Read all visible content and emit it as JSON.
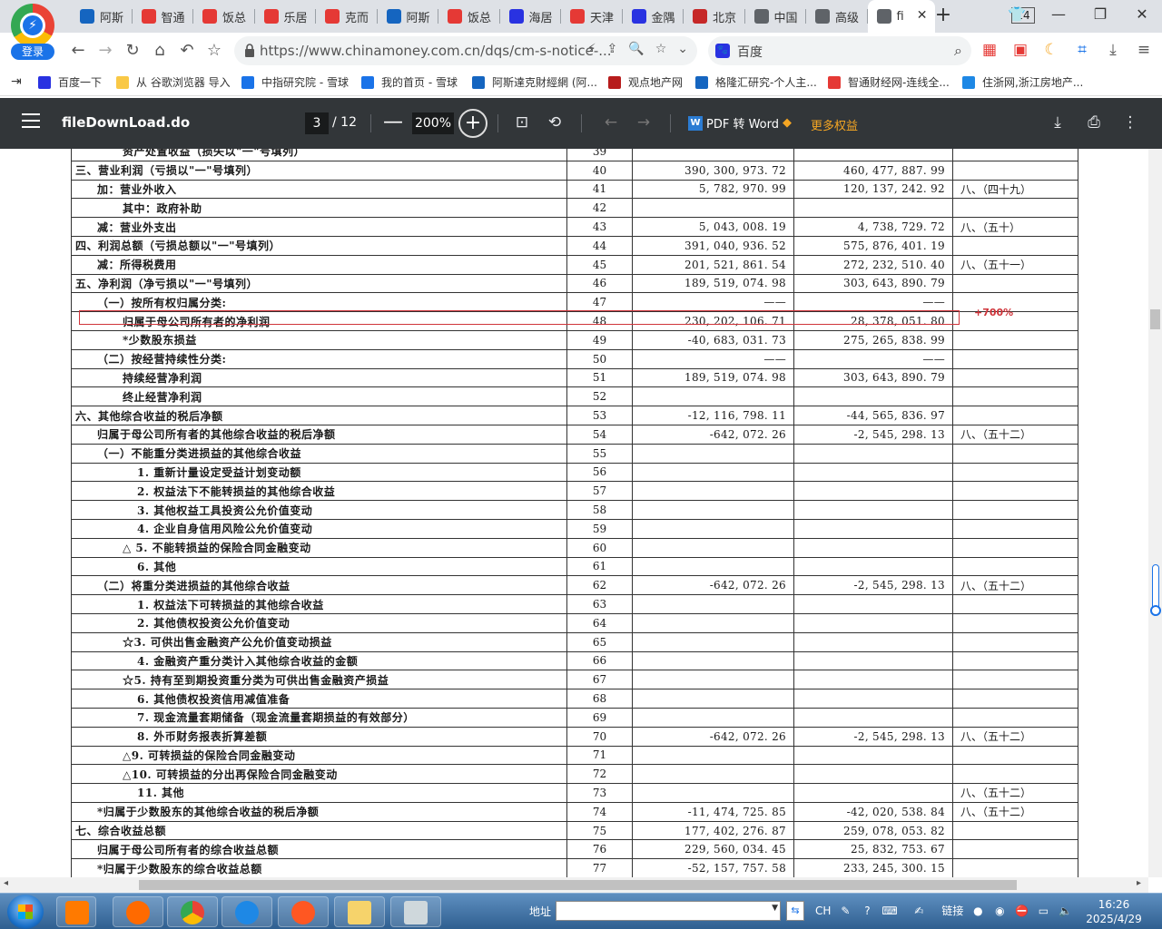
{
  "browser": {
    "login_label": "登录",
    "tabs": [
      {
        "label": "阿斯",
        "icon": "fund-icon",
        "color": "#1565c0"
      },
      {
        "label": "智通",
        "icon": "z-logo-icon",
        "color": "#e53935"
      },
      {
        "label": "饭总",
        "icon": "xueqiu-icon",
        "color": "#e53935"
      },
      {
        "label": "乐居",
        "icon": "xueqiu-icon",
        "color": "#e53935"
      },
      {
        "label": "克而",
        "icon": "xueqiu-icon",
        "color": "#e53935"
      },
      {
        "label": "阿斯",
        "icon": "fund-icon",
        "color": "#1565c0"
      },
      {
        "label": "饭总",
        "icon": "xueqiu-icon",
        "color": "#e53935"
      },
      {
        "label": "海居",
        "icon": "baidu-paw-icon",
        "color": "#2932e1"
      },
      {
        "label": "天津",
        "icon": "xueqiu-icon",
        "color": "#e53935"
      },
      {
        "label": "金隅",
        "icon": "baidu-paw-icon",
        "color": "#2932e1"
      },
      {
        "label": "北京",
        "icon": "news-icon",
        "color": "#c62828"
      },
      {
        "label": "中国",
        "icon": "globe-icon",
        "color": "#5f6368"
      },
      {
        "label": "高级",
        "icon": "globe-icon",
        "color": "#5f6368"
      },
      {
        "label": "fi",
        "icon": "globe-icon",
        "color": "#5f6368",
        "active": true
      }
    ],
    "tab_count": "14",
    "url": "https://www.chinamoney.com.cn/dqs/cm-s-notice-...",
    "search_placeholder": "百度",
    "bookmarks": [
      {
        "label": "百度一下",
        "icon": "baidu-paw-icon",
        "color": "#2932e1"
      },
      {
        "label": "从 谷歌浏览器 导入",
        "icon": "folder-icon",
        "color": "#f9c846"
      },
      {
        "label": "中指研究院 - 雪球",
        "icon": "xueqiu-icon",
        "color": "#1a73e8"
      },
      {
        "label": "我的首页 - 雪球",
        "icon": "xueqiu-icon",
        "color": "#1a73e8"
      },
      {
        "label": "阿斯達克財經網 (阿...",
        "icon": "fund-icon",
        "color": "#1565c0"
      },
      {
        "label": "观点地产网",
        "icon": "guandian-icon",
        "color": "#b71c1c"
      },
      {
        "label": "格隆汇研究-个人主...",
        "icon": "g-logo-icon",
        "color": "#1565c0"
      },
      {
        "label": "智通财经网-连线全...",
        "icon": "z-logo-icon",
        "color": "#e53935"
      },
      {
        "label": "住浙网,浙江房地产...",
        "icon": "key-icon",
        "color": "#1e88e5"
      }
    ]
  },
  "pdf": {
    "filename": "fileDownLoad.do",
    "current_page": "3",
    "total_pages": "/ 12",
    "zoom": "200%",
    "pdf_to_word": "PDF 转 Word",
    "more_rights": "更多权益"
  },
  "table": {
    "cut_off_row": {
      "item": "资产处置收益（损失以\"一\"号填列）",
      "line": "39"
    },
    "rows": [
      {
        "item": "三、营业利润（亏损以\"一\"号填列）",
        "indent": 0,
        "line": "40",
        "cur": "390, 300, 973. 72",
        "prev": "460, 477, 887. 99",
        "note": ""
      },
      {
        "item": "加：营业外收入",
        "indent": 1,
        "line": "41",
        "cur": "5, 782, 970. 99",
        "prev": "120, 137, 242. 92",
        "note": "八、（四十九）"
      },
      {
        "item": "其中：政府补助",
        "indent": 2,
        "line": "42",
        "cur": "",
        "prev": "",
        "note": ""
      },
      {
        "item": "减：营业外支出",
        "indent": 1,
        "line": "43",
        "cur": "5, 043, 008. 19",
        "prev": "4, 738, 729. 72",
        "note": "八、（五十）"
      },
      {
        "item": "四、利润总额（亏损总额以\"一\"号填列）",
        "indent": 0,
        "line": "44",
        "cur": "391, 040, 936. 52",
        "prev": "575, 876, 401. 19",
        "note": ""
      },
      {
        "item": "减：所得税费用",
        "indent": 1,
        "line": "45",
        "cur": "201, 521, 861. 54",
        "prev": "272, 232, 510. 40",
        "note": "八、（五十一）"
      },
      {
        "item": "五、净利润（净亏损以\"一\"号填列）",
        "indent": 0,
        "line": "46",
        "cur": "189, 519, 074. 98",
        "prev": "303, 643, 890. 79",
        "note": ""
      },
      {
        "item": "（一）按所有权归属分类:",
        "indent": 1,
        "line": "47",
        "cur": "——",
        "prev": "——",
        "note": ""
      },
      {
        "item": "归属于母公司所有者的净利润",
        "indent": 2,
        "line": "48",
        "cur": "230, 202, 106. 71",
        "prev": "28, 378, 051. 80",
        "note": ""
      },
      {
        "item": "*少数股东损益",
        "indent": 2,
        "line": "49",
        "cur": "-40, 683, 031. 73",
        "prev": "275, 265, 838. 99",
        "note": ""
      },
      {
        "item": "（二）按经营持续性分类:",
        "indent": 1,
        "line": "50",
        "cur": "——",
        "prev": "——",
        "note": ""
      },
      {
        "item": "持续经营净利润",
        "indent": 2,
        "line": "51",
        "cur": "189, 519, 074. 98",
        "prev": "303, 643, 890. 79",
        "note": ""
      },
      {
        "item": "终止经营净利润",
        "indent": 2,
        "line": "52",
        "cur": "",
        "prev": "",
        "note": ""
      },
      {
        "item": "六、其他综合收益的税后净额",
        "indent": 0,
        "line": "53",
        "cur": "-12, 116, 798. 11",
        "prev": "-44, 565, 836. 97",
        "note": ""
      },
      {
        "item": "归属于母公司所有者的其他综合收益的税后净额",
        "indent": 1,
        "line": "54",
        "cur": "-642, 072. 26",
        "prev": "-2, 545, 298. 13",
        "note": "八、（五十二）"
      },
      {
        "item": "（一）不能重分类进损益的其他综合收益",
        "indent": 1,
        "line": "55",
        "cur": "",
        "prev": "",
        "note": ""
      },
      {
        "item": "1. 重新计量设定受益计划变动额",
        "indent": 3,
        "line": "56",
        "cur": "",
        "prev": "",
        "note": ""
      },
      {
        "item": "2. 权益法下不能转损益的其他综合收益",
        "indent": 3,
        "line": "57",
        "cur": "",
        "prev": "",
        "note": ""
      },
      {
        "item": "3. 其他权益工具投资公允价值变动",
        "indent": 3,
        "line": "58",
        "cur": "",
        "prev": "",
        "note": ""
      },
      {
        "item": "4. 企业自身信用风险公允价值变动",
        "indent": 3,
        "line": "59",
        "cur": "",
        "prev": "",
        "note": ""
      },
      {
        "item": "△ 5. 不能转损益的保险合同金融变动",
        "indent": 2,
        "line": "60",
        "cur": "",
        "prev": "",
        "note": ""
      },
      {
        "item": "6. 其他",
        "indent": 3,
        "line": "61",
        "cur": "",
        "prev": "",
        "note": ""
      },
      {
        "item": "（二）将重分类进损益的其他综合收益",
        "indent": 1,
        "line": "62",
        "cur": "-642, 072. 26",
        "prev": "-2, 545, 298. 13",
        "note": "八、（五十二）"
      },
      {
        "item": "1. 权益法下可转损益的其他综合收益",
        "indent": 3,
        "line": "63",
        "cur": "",
        "prev": "",
        "note": ""
      },
      {
        "item": "2. 其他债权投资公允价值变动",
        "indent": 3,
        "line": "64",
        "cur": "",
        "prev": "",
        "note": ""
      },
      {
        "item": "☆3. 可供出售金融资产公允价值变动损益",
        "indent": 2,
        "line": "65",
        "cur": "",
        "prev": "",
        "note": ""
      },
      {
        "item": "4. 金融资产重分类计入其他综合收益的金额",
        "indent": 3,
        "line": "66",
        "cur": "",
        "prev": "",
        "note": ""
      },
      {
        "item": "☆5. 持有至到期投资重分类为可供出售金融资产损益",
        "indent": 2,
        "line": "67",
        "cur": "",
        "prev": "",
        "note": ""
      },
      {
        "item": "6. 其他债权投资信用减值准备",
        "indent": 3,
        "line": "68",
        "cur": "",
        "prev": "",
        "note": ""
      },
      {
        "item": "7. 现金流量套期储备（现金流量套期损益的有效部分）",
        "indent": 3,
        "line": "69",
        "cur": "",
        "prev": "",
        "note": ""
      },
      {
        "item": "8. 外币财务报表折算差额",
        "indent": 3,
        "line": "70",
        "cur": "-642, 072. 26",
        "prev": "-2, 545, 298. 13",
        "note": "八、（五十二）"
      },
      {
        "item": "△9. 可转损益的保险合同金融变动",
        "indent": 2,
        "line": "71",
        "cur": "",
        "prev": "",
        "note": ""
      },
      {
        "item": "△10. 可转损益的分出再保险合同金融变动",
        "indent": 2,
        "line": "72",
        "cur": "",
        "prev": "",
        "note": ""
      },
      {
        "item": "11. 其他",
        "indent": 3,
        "line": "73",
        "cur": "",
        "prev": "",
        "note": "八、（五十二）"
      },
      {
        "item": "*归属于少数股东的其他综合收益的税后净额",
        "indent": 1,
        "line": "74",
        "cur": "-11, 474, 725. 85",
        "prev": "-42, 020, 538. 84",
        "note": "八、（五十二）"
      },
      {
        "item": "七、综合收益总额",
        "indent": 0,
        "line": "75",
        "cur": "177, 402, 276. 87",
        "prev": "259, 078, 053. 82",
        "note": ""
      },
      {
        "item": "归属于母公司所有者的综合收益总额",
        "indent": 1,
        "line": "76",
        "cur": "229, 560, 034. 45",
        "prev": "25, 832, 753. 67",
        "note": ""
      },
      {
        "item": "*归属于少数股东的综合收益总额",
        "indent": 1,
        "line": "77",
        "cur": "-52, 157, 757. 58",
        "prev": "233, 245, 300. 15",
        "note": ""
      }
    ]
  },
  "annotation": {
    "highlight_line": "48",
    "text": "+700%",
    "color": "#d0343a"
  },
  "taskbar": {
    "address_label": "地址",
    "lang": "CH",
    "link_label": "链接",
    "time": "16:26",
    "date": "2025/4/29"
  }
}
